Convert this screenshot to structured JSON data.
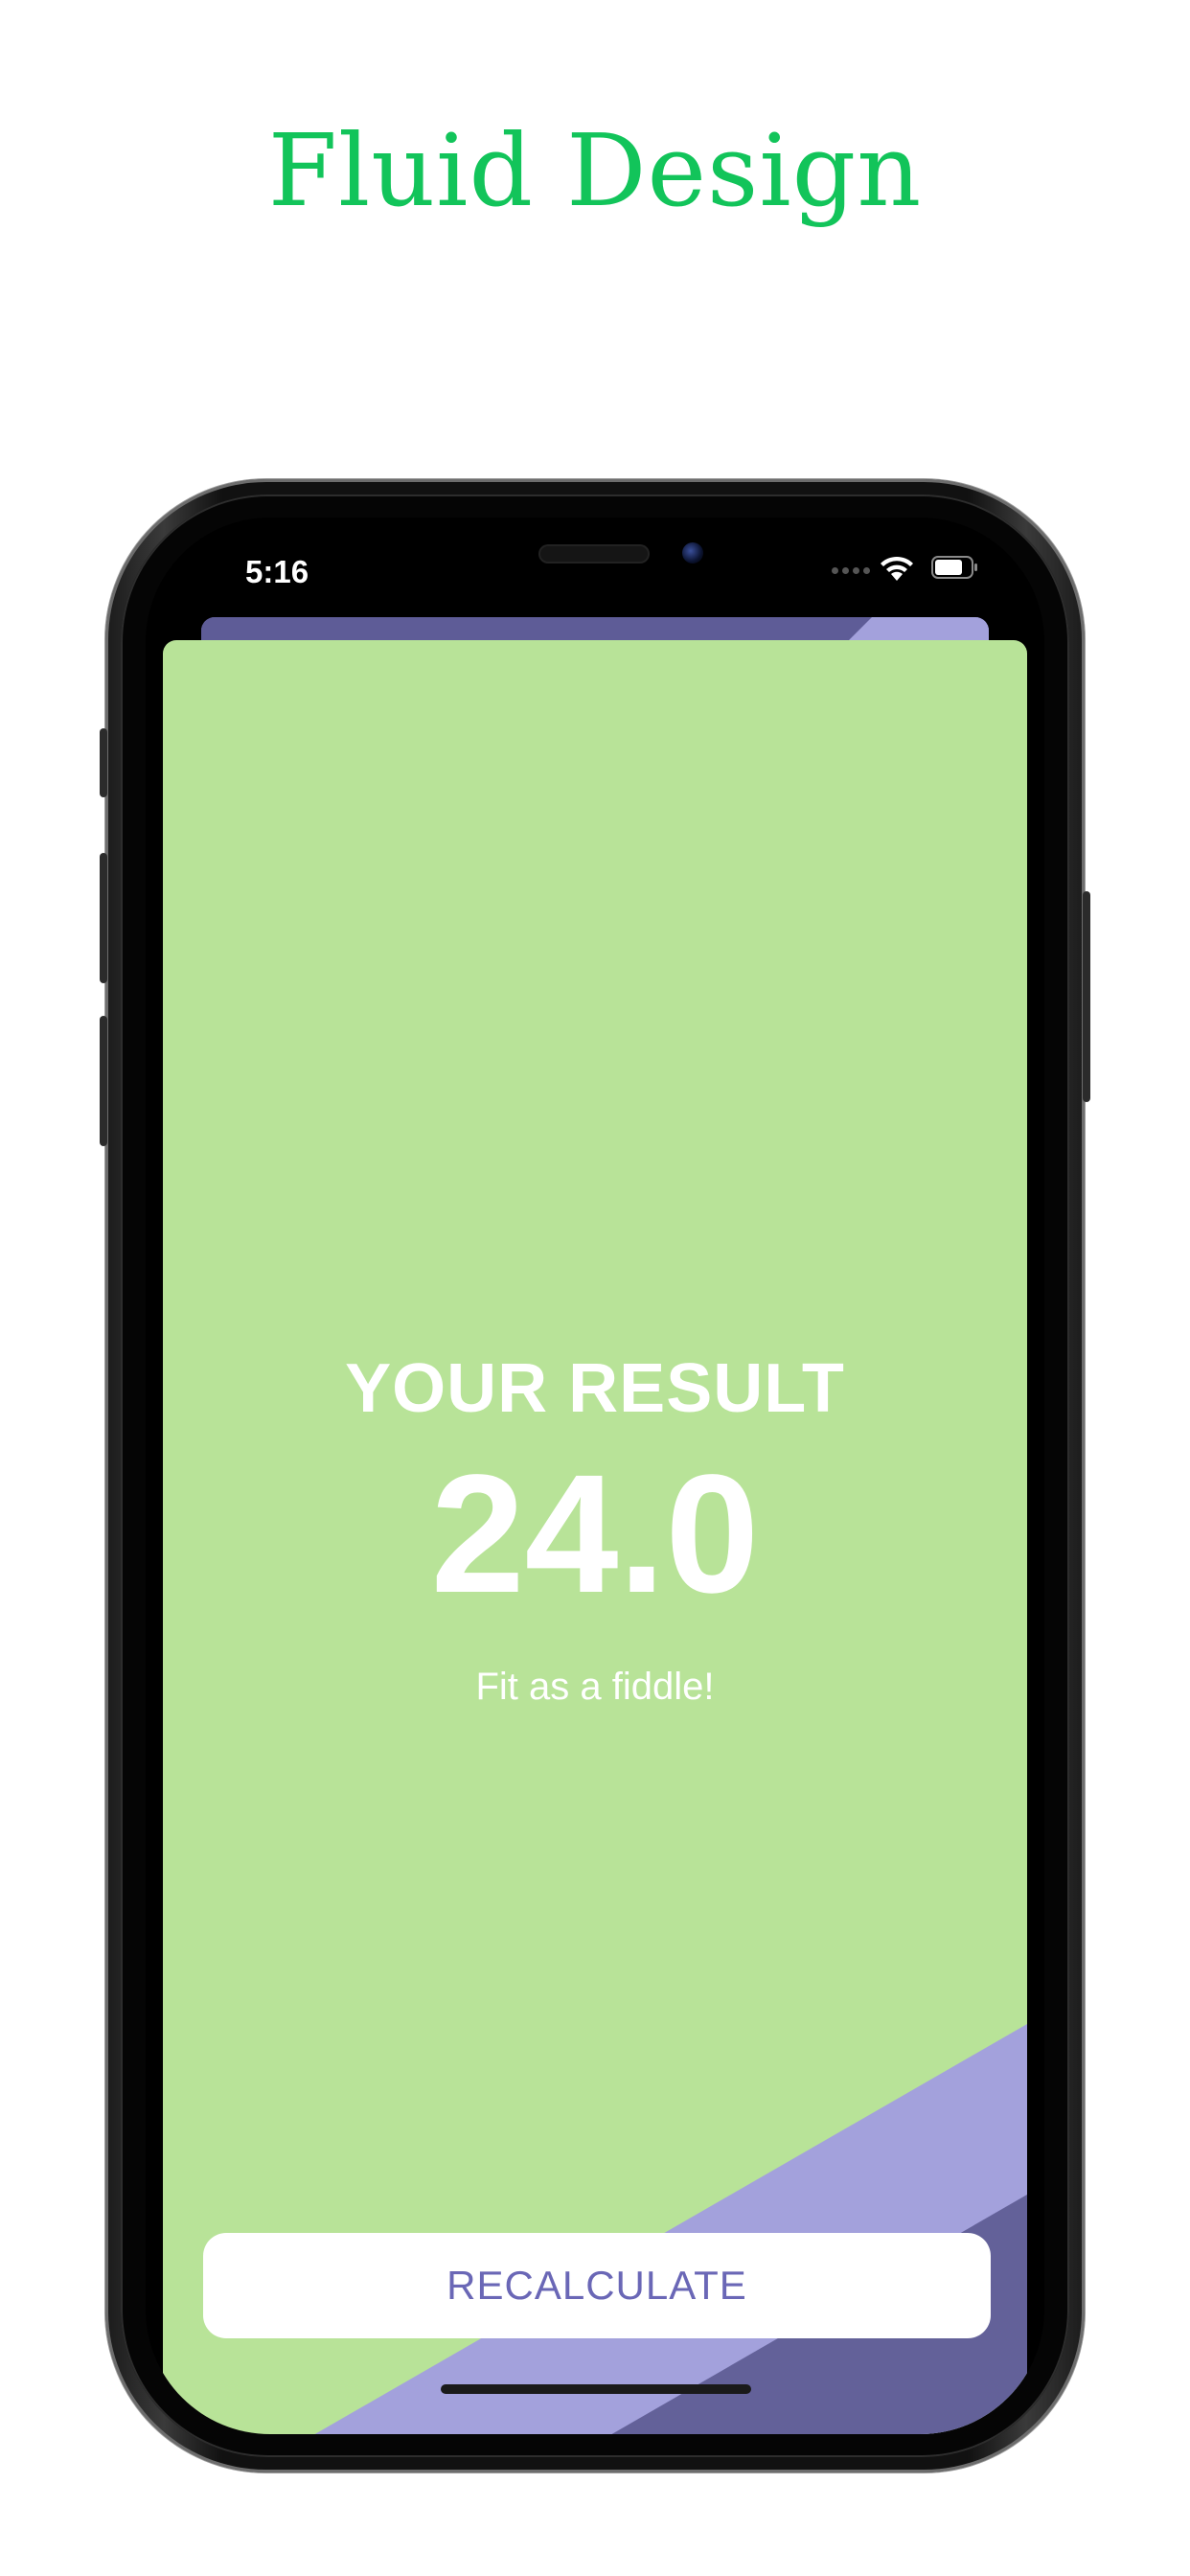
{
  "headline": "Fluid Design",
  "status_bar": {
    "time": "5:16"
  },
  "result": {
    "label": "YOUR RESULT",
    "value": "24.0",
    "message": "Fit as a fiddle!"
  },
  "actions": {
    "recalculate_label": "RECALCULATE"
  },
  "colors": {
    "headline": "#12c45a",
    "card_background": "#b8e398",
    "stripe_light": "#a3a1dc",
    "stripe_dark": "#636199",
    "button_text": "#6a67b6"
  },
  "icons": [
    "wifi-icon",
    "battery-icon",
    "signal-dots-icon"
  ]
}
